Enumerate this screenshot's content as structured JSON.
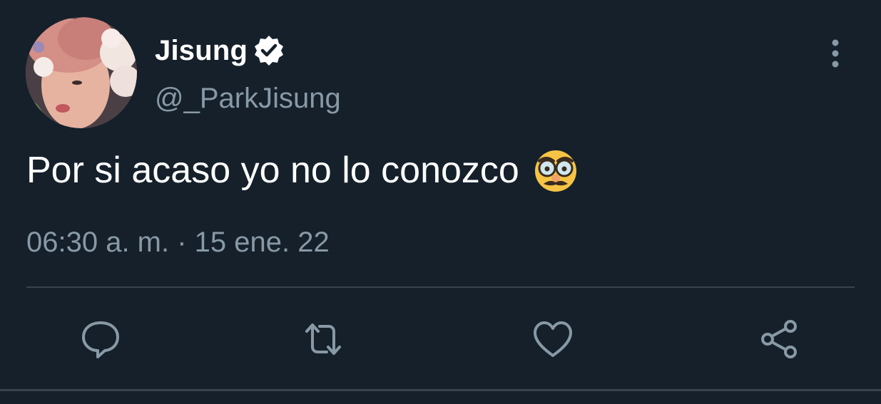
{
  "tweet": {
    "display_name": "Jisung",
    "verified": true,
    "handle": "@_ParkJisung",
    "text": "Por si acaso yo no lo conozco",
    "emoji": "disguised-face-emoji",
    "timestamp": "06:30 a. m. · 15 ene. 22"
  },
  "icons": {
    "more": "vertical-ellipsis-icon",
    "reply": "reply-icon",
    "retweet": "retweet-icon",
    "like": "heart-icon",
    "share": "share-icon",
    "verified": "verified-badge-icon"
  },
  "colors": {
    "background": "#15202b",
    "primary_text": "#ffffff",
    "secondary_text": "#8899a6",
    "divider": "#38444d",
    "verified_badge": "#ffffff"
  }
}
